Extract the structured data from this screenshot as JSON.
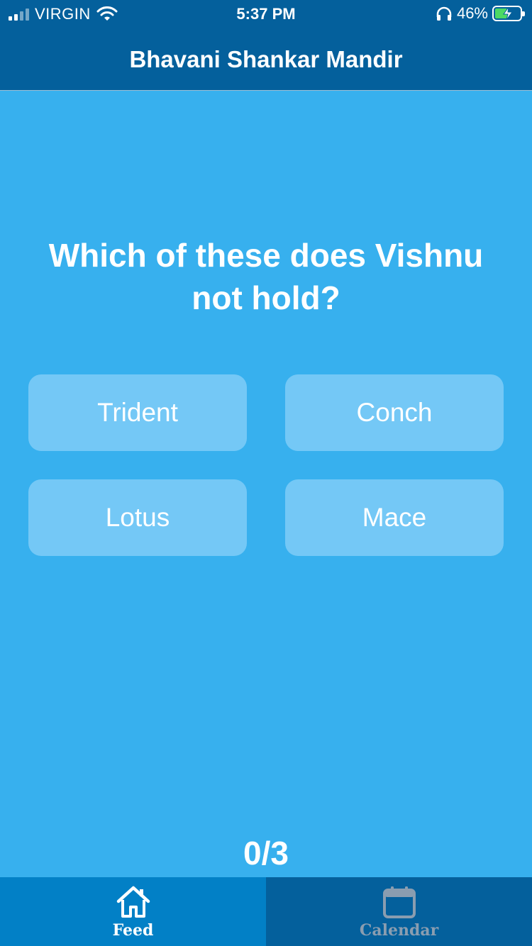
{
  "status_bar": {
    "carrier": "VIRGIN",
    "time": "5:37 PM",
    "battery_percent": "46%",
    "battery_level": 0.46,
    "icons": [
      "signal-icon",
      "wifi-icon",
      "headphones-icon",
      "battery-charging-icon"
    ]
  },
  "header": {
    "title": "Bhavani Shankar Mandir"
  },
  "quiz": {
    "question": "Which of these does Vishnu not hold?",
    "answers": [
      "Trident",
      "Conch",
      "Lotus",
      "Mace"
    ],
    "progress": "0/3"
  },
  "tabbar": {
    "tabs": [
      {
        "label": "Feed",
        "icon": "home-icon",
        "active": true
      },
      {
        "label": "Calendar",
        "icon": "calendar-icon",
        "active": false
      }
    ]
  },
  "colors": {
    "background": "#37b0ee",
    "header": "#04609c",
    "answer_button": "#74c8f6",
    "active_tab": "#0280c6",
    "inactive_tab_label": "#8a9db0",
    "battery_fill": "#4cd964"
  }
}
